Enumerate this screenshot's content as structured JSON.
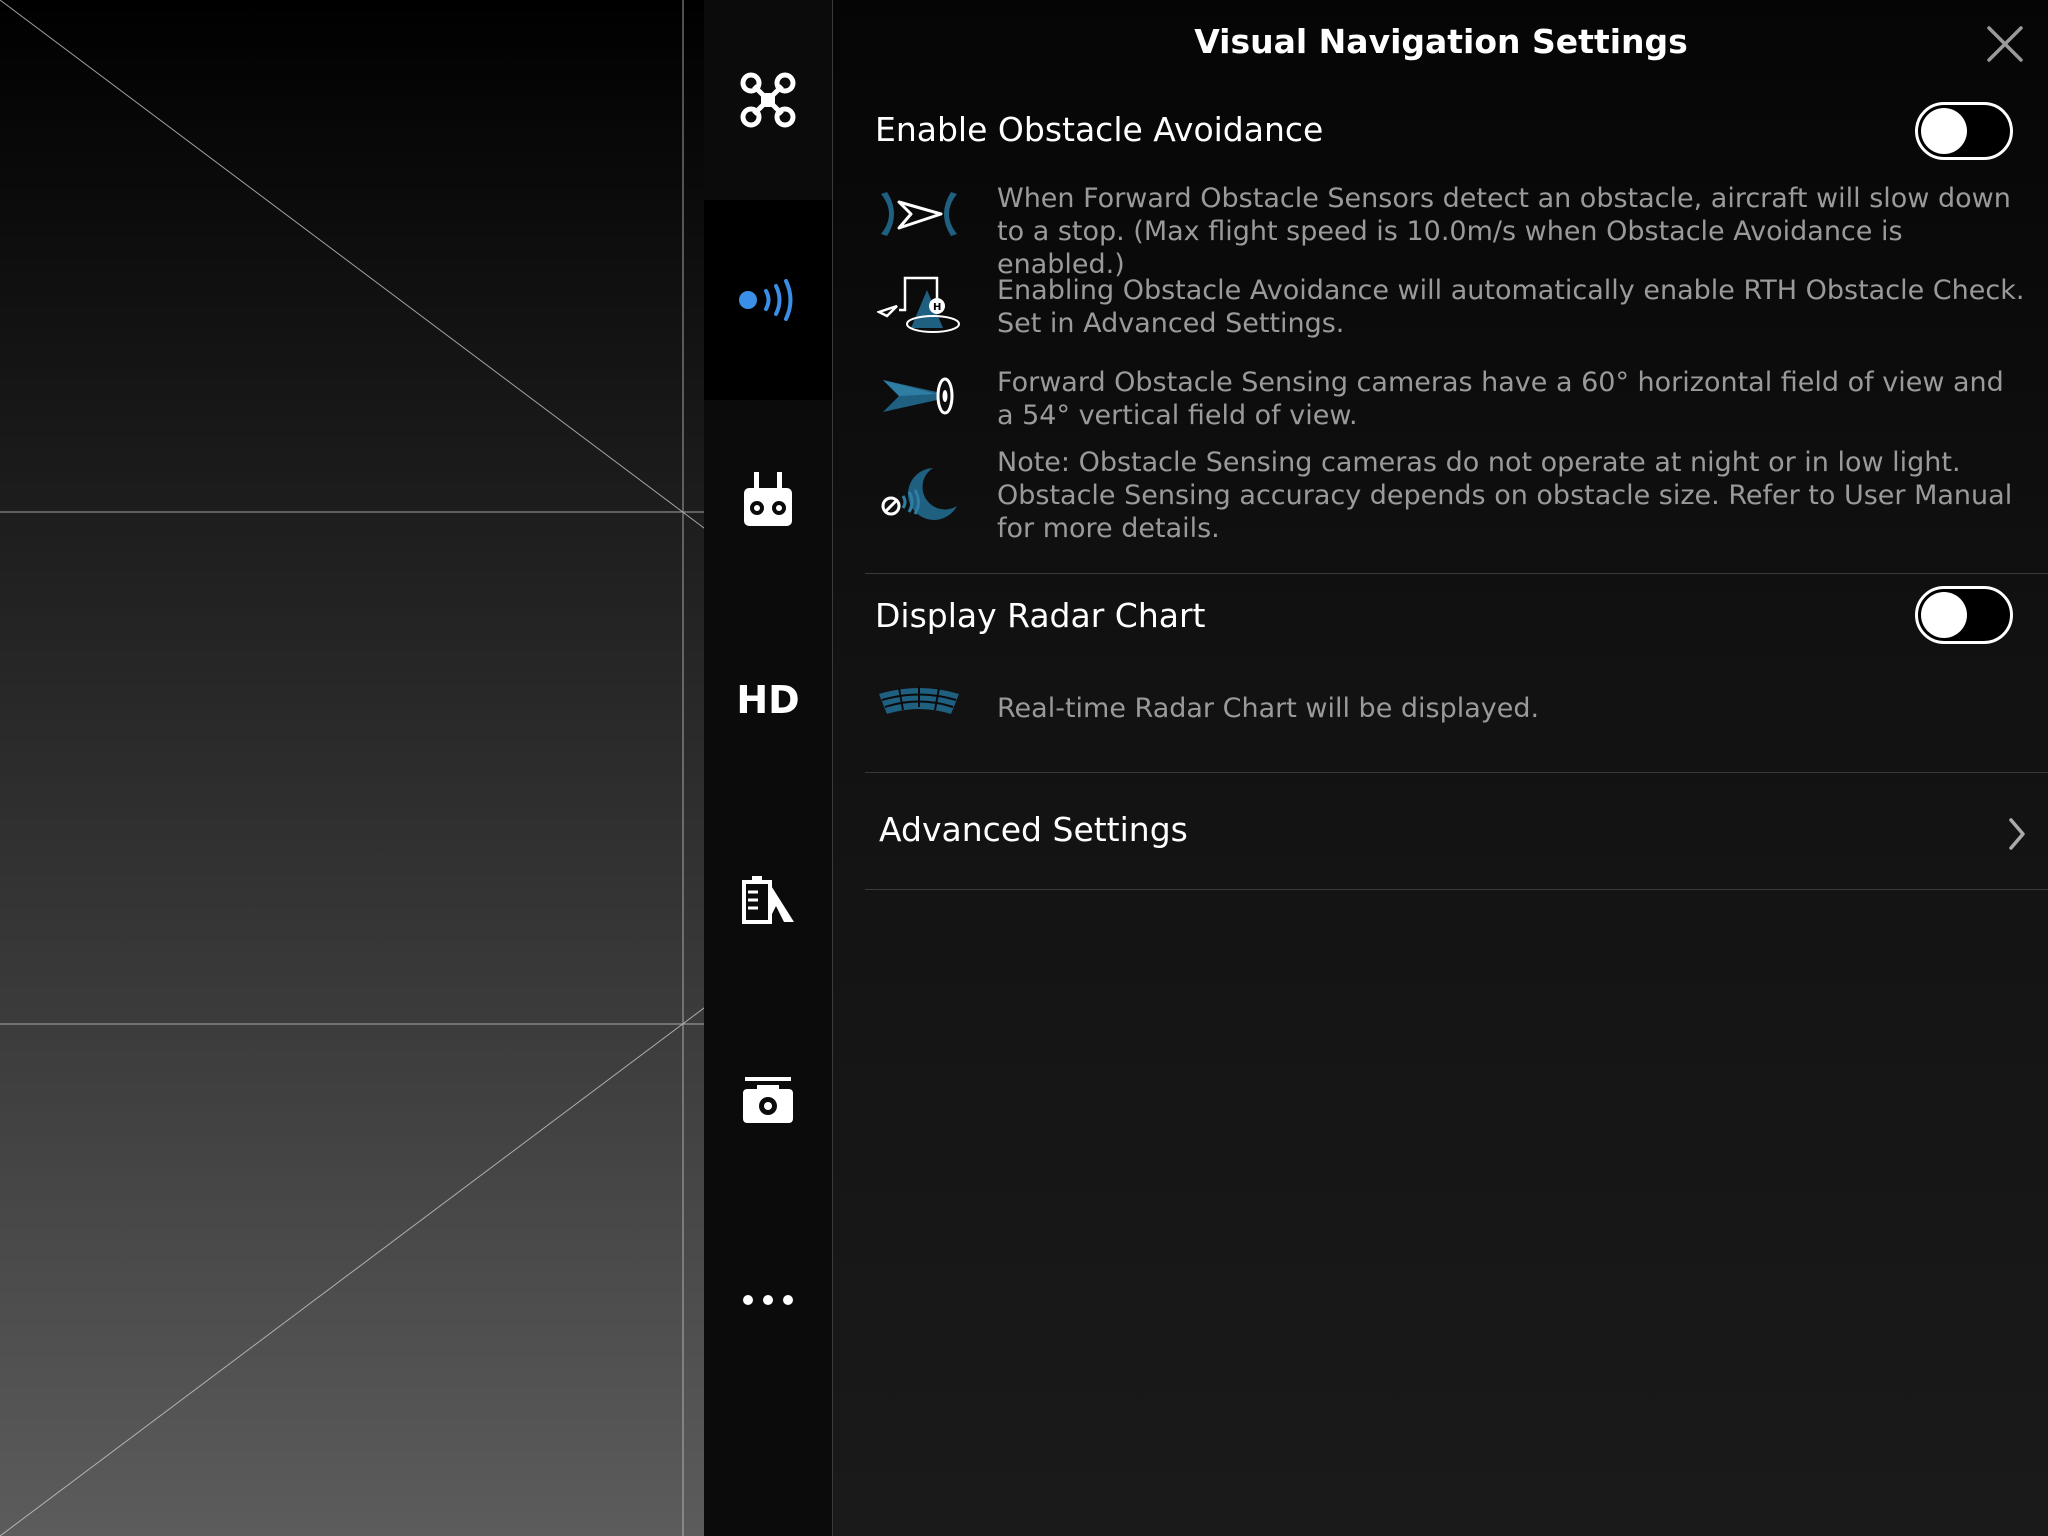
{
  "header": {
    "title": "Visual Navigation Settings"
  },
  "sidebar": {
    "items": [
      {
        "name": "aircraft",
        "icon": "drone-icon"
      },
      {
        "name": "visual-navigation",
        "icon": "obstacle-sensor-icon",
        "active": true,
        "accent": "#3a8ee6"
      },
      {
        "name": "remote-controller",
        "icon": "remote-controller-icon"
      },
      {
        "name": "hd",
        "label": "HD"
      },
      {
        "name": "battery",
        "icon": "battery-icon"
      },
      {
        "name": "camera",
        "icon": "camera-icon"
      },
      {
        "name": "more",
        "icon": "more-dots-icon"
      }
    ]
  },
  "obstacle_avoidance": {
    "label": "Enable Obstacle Avoidance",
    "enabled": false,
    "notes": [
      {
        "icon": "forward-sensor-icon",
        "text": "When Forward Obstacle Sensors detect an obstacle, aircraft will slow down to a stop. (Max flight speed is 10.0m/s when Obstacle Avoidance is enabled.)"
      },
      {
        "icon": "rth-obstacle-check-icon",
        "text": "Enabling Obstacle Avoidance will automatically enable RTH Obstacle Check. Set in Advanced Settings."
      },
      {
        "icon": "field-of-view-icon",
        "text": "Forward Obstacle Sensing cameras have a 60° horizontal field of view and a 54° vertical field of view."
      },
      {
        "icon": "low-light-icon",
        "text": "Note: Obstacle Sensing cameras do not operate at night or in low light. Obstacle Sensing accuracy depends on obstacle size. Refer to User Manual for more details."
      }
    ]
  },
  "radar_chart": {
    "label": "Display Radar Chart",
    "enabled": false,
    "note": {
      "icon": "radar-chart-icon",
      "text": "Real-time Radar Chart will be displayed."
    }
  },
  "advanced": {
    "label": "Advanced Settings"
  }
}
